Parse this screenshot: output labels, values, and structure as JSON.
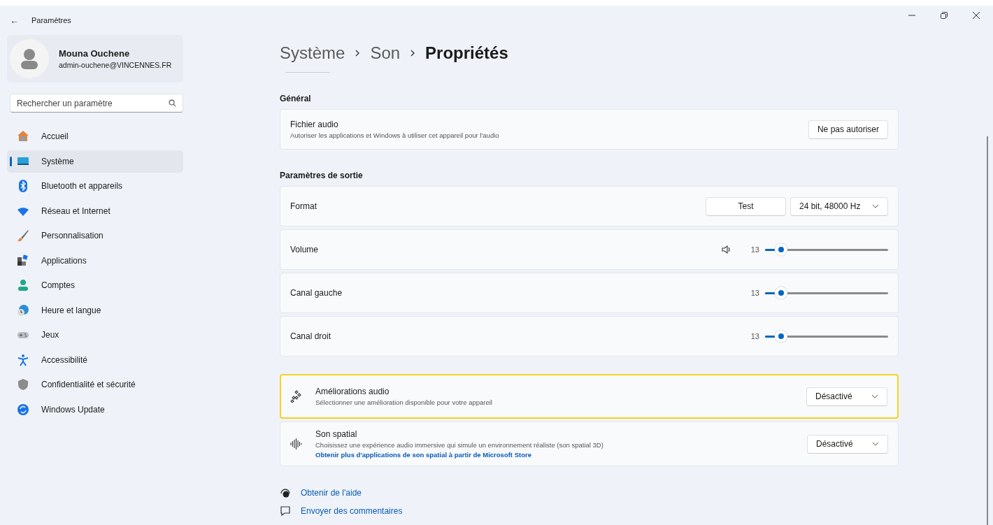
{
  "window": {
    "title": "Paramètres",
    "back": "←"
  },
  "profile": {
    "name": "Mouna Ouchene",
    "email": "admin-ouchene@VINCENNES.FR"
  },
  "search": {
    "placeholder": "Rechercher un paramètre"
  },
  "sidebar": {
    "items": [
      {
        "label": "Accueil",
        "selected": false
      },
      {
        "label": "Système",
        "selected": true
      },
      {
        "label": "Bluetooth et appareils",
        "selected": false
      },
      {
        "label": "Réseau et Internet",
        "selected": false
      },
      {
        "label": "Personnalisation",
        "selected": false
      },
      {
        "label": "Applications",
        "selected": false
      },
      {
        "label": "Comptes",
        "selected": false
      },
      {
        "label": "Heure et langue",
        "selected": false
      },
      {
        "label": "Jeux",
        "selected": false
      },
      {
        "label": "Accessibilité",
        "selected": false
      },
      {
        "label": "Confidentialité et sécurité",
        "selected": false
      },
      {
        "label": "Windows Update",
        "selected": false
      }
    ]
  },
  "breadcrumb": [
    {
      "label": "Système",
      "current": false
    },
    {
      "label": "Son",
      "current": false
    },
    {
      "label": "Propriétés",
      "current": true
    }
  ],
  "sections": [
    {
      "title": "Général",
      "rows": [
        {
          "kind": "button",
          "label": "Fichier audio",
          "description": "Autoriser les applications et Windows à utiliser cet appareil pour l'audio",
          "button": "Ne pas autoriser"
        }
      ]
    },
    {
      "title": "Paramètres de sortie",
      "rows": [
        {
          "kind": "format",
          "label": "Format",
          "button": "Test",
          "dropdown": "24 bit, 48000 Hz"
        },
        {
          "kind": "slider",
          "label": "Volume",
          "speaker": true,
          "reading": "13",
          "level": 0.13
        },
        {
          "kind": "slider",
          "label": "Canal gauche",
          "speaker": false,
          "reading": "13",
          "level": 0.13
        },
        {
          "kind": "slider",
          "label": "Canal droit",
          "speaker": false,
          "reading": "13",
          "level": 0.13
        }
      ]
    },
    {
      "rows": [
        {
          "kind": "dropdown",
          "label": "Améliorations audio",
          "description": "Sélectionner une amélioration disponible pour votre appareil",
          "dropdown": "Désactivé",
          "highlighted": true
        },
        {
          "kind": "dropdown",
          "label": "Son spatial",
          "description": "Choisissez une expérience audio immersive qui simule un environnement réaliste (son spatial 3D)",
          "link": "Obtenir plus d'applications de son spatial à partir de Microsoft Store",
          "dropdown": "Désactivé",
          "highlighted": false
        }
      ]
    }
  ],
  "footer_links": [
    {
      "label": "Obtenir de l'aide"
    },
    {
      "label": "Envoyer des commentaires"
    }
  ]
}
